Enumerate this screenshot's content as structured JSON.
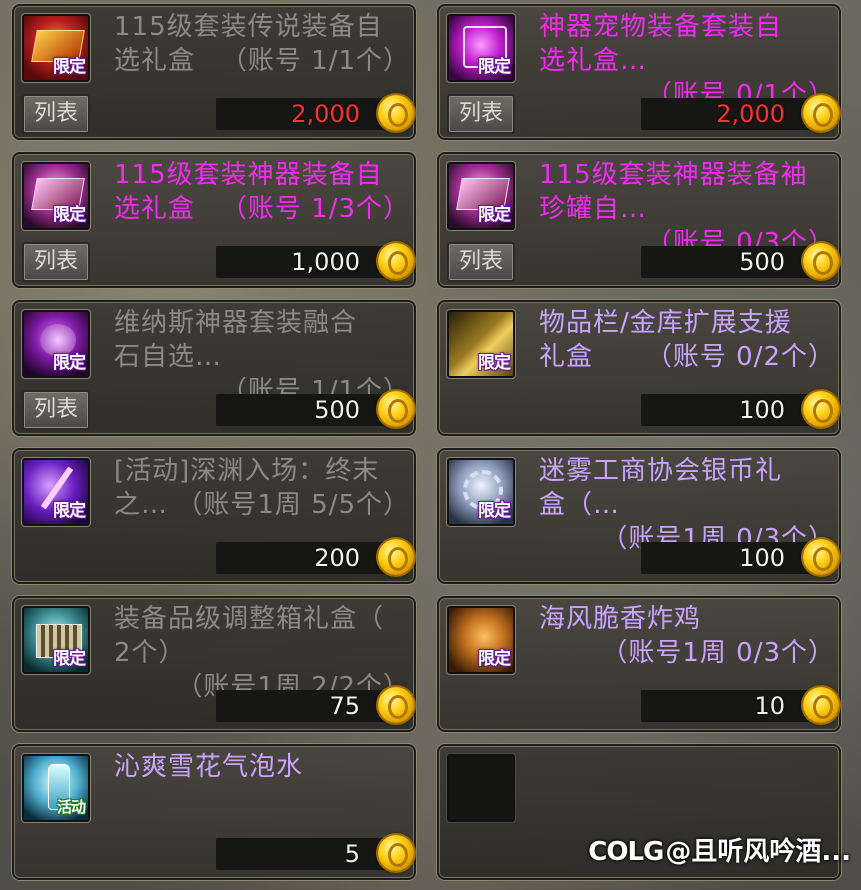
{
  "items": [
    {
      "title": "115级套装传说装备自\n选礼盒",
      "limit": "（账号 1/1个）",
      "price": "2,000",
      "price_color": "red",
      "tag": "限定",
      "list_btn": "列表",
      "title_color": "gray",
      "icon": "gift-box-red-icon"
    },
    {
      "title": "神器宠物装备套装自\n选礼盒…",
      "limit": "（账号 0/1个）",
      "price": "2,000",
      "price_color": "red",
      "tag": "限定",
      "list_btn": "列表",
      "title_color": "pink",
      "icon": "artifact-pet-box-icon"
    },
    {
      "title": "115级套装神器装备自\n选礼盒",
      "limit": "（账号 1/3个）",
      "price": "1,000",
      "price_color": "white",
      "tag": "限定",
      "list_btn": "列表",
      "title_color": "pink",
      "icon": "gift-box-pink-icon"
    },
    {
      "title": "115级套装神器装备袖\n珍罐自…",
      "limit": "（账号 0/3个）",
      "price": "500",
      "price_color": "white",
      "tag": "限定",
      "list_btn": "列表",
      "title_color": "pink",
      "icon": "gift-box-pink-icon"
    },
    {
      "title": "维纳斯神器套装融合\n石自选…",
      "limit": "（账号 1/1个）",
      "price": "500",
      "price_color": "white",
      "tag": "限定",
      "list_btn": "列表",
      "title_color": "gray",
      "icon": "fusion-stone-box-icon"
    },
    {
      "title": "物品栏/金库扩展支援\n礼盒",
      "limit": "（账号 0/2个）",
      "price": "100",
      "price_color": "white",
      "tag": "限定",
      "list_btn": "",
      "title_color": "lavender",
      "icon": "gold-box-icon"
    },
    {
      "title": "[活动]深渊入场：终末\n之…",
      "limit": "（账号1周 5/5个）",
      "price": "200",
      "price_color": "white",
      "tag": "限定",
      "list_btn": "",
      "title_color": "gray",
      "icon": "abyss-ticket-icon"
    },
    {
      "title": "迷雾工商协会银币礼\n盒（…",
      "limit": "（账号1周 0/3个）",
      "price": "100",
      "price_color": "white",
      "tag": "限定",
      "list_btn": "",
      "title_color": "lavender",
      "icon": "silver-coin-box-icon"
    },
    {
      "title": "装备品级调整箱礼盒（\n2个）",
      "limit": "（账号1周 2/2个）",
      "price": "75",
      "price_color": "white",
      "tag": "限定",
      "list_btn": "",
      "title_color": "gray",
      "icon": "grade-adjust-box-icon"
    },
    {
      "title": "海风脆香炸鸡\n",
      "limit": "（账号1周 0/3个）",
      "price": "10",
      "price_color": "white",
      "tag": "限定",
      "list_btn": "",
      "title_color": "lavender",
      "icon": "fried-chicken-icon"
    },
    {
      "title": "沁爽雪花气泡水",
      "limit": "",
      "price": "5",
      "price_color": "white",
      "tag": "活动",
      "list_btn": "",
      "title_color": "lavender",
      "icon": "soda-bottle-icon"
    }
  ],
  "watermark": {
    "logo": "COLG",
    "text": "@且听风吟酒..."
  },
  "colors": {
    "red_price": "#ff3030",
    "pink_title": "#f02cf0",
    "lavender_title": "#c9a3ff",
    "gray_title": "#8c8a84"
  }
}
